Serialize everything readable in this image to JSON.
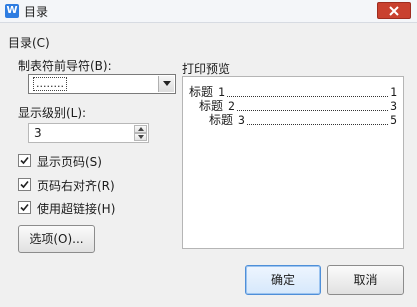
{
  "window": {
    "title": "目录",
    "close_icon": "close-icon",
    "app_icon": "W"
  },
  "dialog": {
    "group_label": "目录(C)",
    "leader_label": "制表符前导符(B):",
    "leader_value": "........",
    "level_label": "显示级别(L):",
    "level_value": "3",
    "checkboxes": [
      {
        "label": "显示页码(S)",
        "checked": true
      },
      {
        "label": "页码右对齐(R)",
        "checked": true
      },
      {
        "label": "使用超链接(H)",
        "checked": true
      }
    ],
    "options_button": "选项(O)...",
    "ok_button": "确定",
    "cancel_button": "取消"
  },
  "preview": {
    "label": "打印预览",
    "entries": [
      {
        "title": "标题",
        "num": "1",
        "page": "1"
      },
      {
        "title": "标题",
        "num": "2",
        "page": "3"
      },
      {
        "title": "标题",
        "num": "3",
        "page": "5"
      }
    ]
  },
  "colors": {
    "close_button": "#c9412f",
    "ok_border": "#4f8fd8",
    "app_icon": "#2f7de1"
  }
}
